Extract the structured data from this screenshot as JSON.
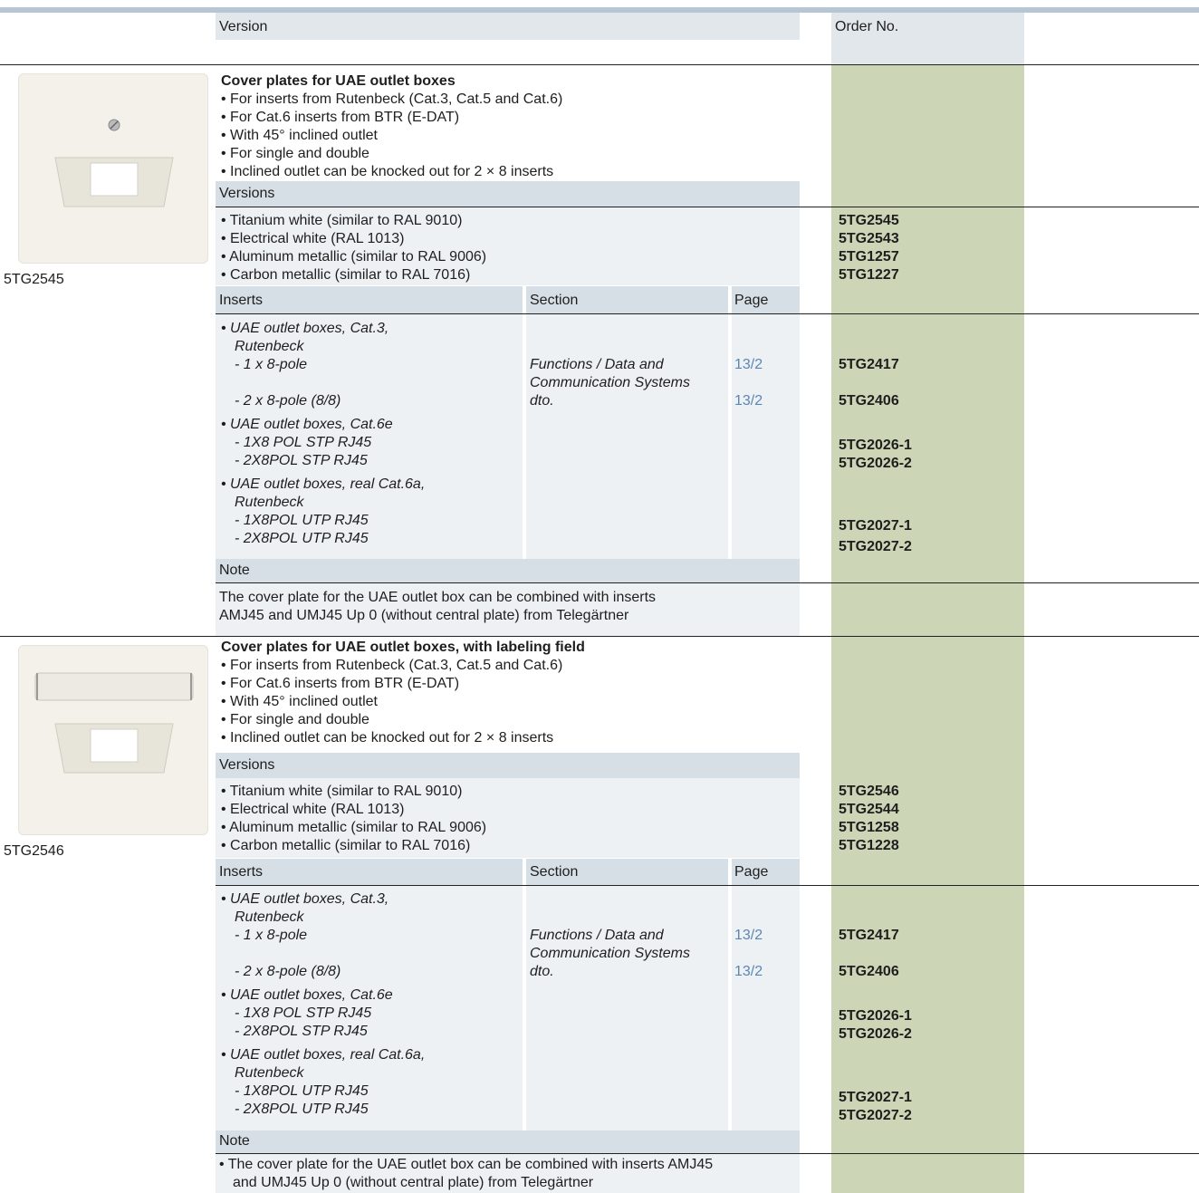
{
  "header": {
    "version": "Version",
    "order_no": "Order No."
  },
  "sections": [
    {
      "title": "Cover plates for UAE outlet boxes",
      "bullets": [
        "• For inserts from Rutenbeck (Cat.3, Cat.5 and Cat.6)",
        "• For Cat.6 inserts from BTR (E-DAT)",
        "• With 45° inclined outlet",
        "• For single and double",
        "• Inclined outlet can be knocked out for 2 × 8 inserts"
      ],
      "image_label": "5TG2545",
      "versions_label": "Versions",
      "versions": [
        "• Titanium white (similar to RAL 9010)",
        "• Electrical white (RAL 1013)",
        "• Aluminum metallic (similar to RAL 9006)",
        "• Carbon metallic (similar to RAL 7016)"
      ],
      "version_orders": [
        "5TG2545",
        "5TG2543",
        "5TG1257",
        "5TG1227"
      ],
      "inserts_label": "Inserts",
      "section_label": "Section",
      "page_label": "Page",
      "ins": {
        "g1a": "• UAE outlet boxes, Cat.3,",
        "g1b": "Rutenbeck",
        "g1c": "- 1 x 8-pole",
        "g1d": "- 2 x 8-pole (8/8)",
        "sec1": "Functions / Data and",
        "sec2": "Communication Systems",
        "sec3": "dto.",
        "pg1": "13/2",
        "pg2": "13/2",
        "o1": "5TG2417",
        "o2": "5TG2406",
        "g2a": "• UAE outlet boxes, Cat.6e",
        "g2b": "- 1X8 POL STP RJ45",
        "g2c": "- 2X8POL STP RJ45",
        "o3": "5TG2026-1",
        "o4": "5TG2026-2",
        "g3a": "• UAE outlet boxes, real Cat.6a,",
        "g3b": "Rutenbeck",
        "g3c": "- 1X8POL UTP RJ45",
        "g3d": "- 2X8POL UTP RJ45",
        "o5": "5TG2027-1",
        "o6": "5TG2027-2"
      },
      "note_label": "Note",
      "note_lines": [
        "The cover plate for the UAE outlet box can be combined with inserts",
        "AMJ45 and UMJ45 Up 0 (without central plate) from Telegärtner"
      ]
    },
    {
      "title": "Cover plates for UAE outlet boxes, with labeling field",
      "bullets": [
        "• For inserts from Rutenbeck (Cat.3, Cat.5 and Cat.6)",
        "• For Cat.6 inserts from BTR (E-DAT)",
        "• With 45° inclined outlet",
        "• For single and double",
        "• Inclined outlet can be knocked out for 2 × 8 inserts"
      ],
      "image_label": "5TG2546",
      "versions_label": "Versions",
      "versions": [
        "• Titanium white (similar to RAL 9010)",
        "• Electrical white (RAL 1013)",
        "• Aluminum metallic (similar to RAL 9006)",
        "• Carbon metallic (similar to RAL 7016)"
      ],
      "version_orders": [
        "5TG2546",
        "5TG2544",
        "5TG1258",
        "5TG1228"
      ],
      "inserts_label": "Inserts",
      "section_label": "Section",
      "page_label": "Page",
      "ins": {
        "g1a": "• UAE outlet boxes, Cat.3,",
        "g1b": "Rutenbeck",
        "g1c": "- 1 x 8-pole",
        "g1d": "- 2 x 8-pole (8/8)",
        "sec1": "Functions / Data and",
        "sec2": "Communication Systems",
        "sec3": "dto.",
        "pg1": "13/2",
        "pg2": "13/2",
        "o1": "5TG2417",
        "o2": "5TG2406",
        "g2a": "• UAE outlet boxes, Cat.6e",
        "g2b": "- 1X8 POL STP RJ45",
        "g2c": "- 2X8POL STP RJ45",
        "o3": "5TG2026-1",
        "o4": "5TG2026-2",
        "g3a": "• UAE outlet boxes, real Cat.6a,",
        "g3b": "Rutenbeck",
        "g3c": "- 1X8POL UTP RJ45",
        "g3d": "- 2X8POL UTP RJ45",
        "o5": "5TG2027-1",
        "o6": "5TG2027-2"
      },
      "note_label": "Note",
      "note_lines": [
        "• The cover plate for the UAE outlet box can be combined with inserts AMJ45",
        "and UMJ45 Up 0 (without central plate) from Telegärtner"
      ]
    }
  ]
}
